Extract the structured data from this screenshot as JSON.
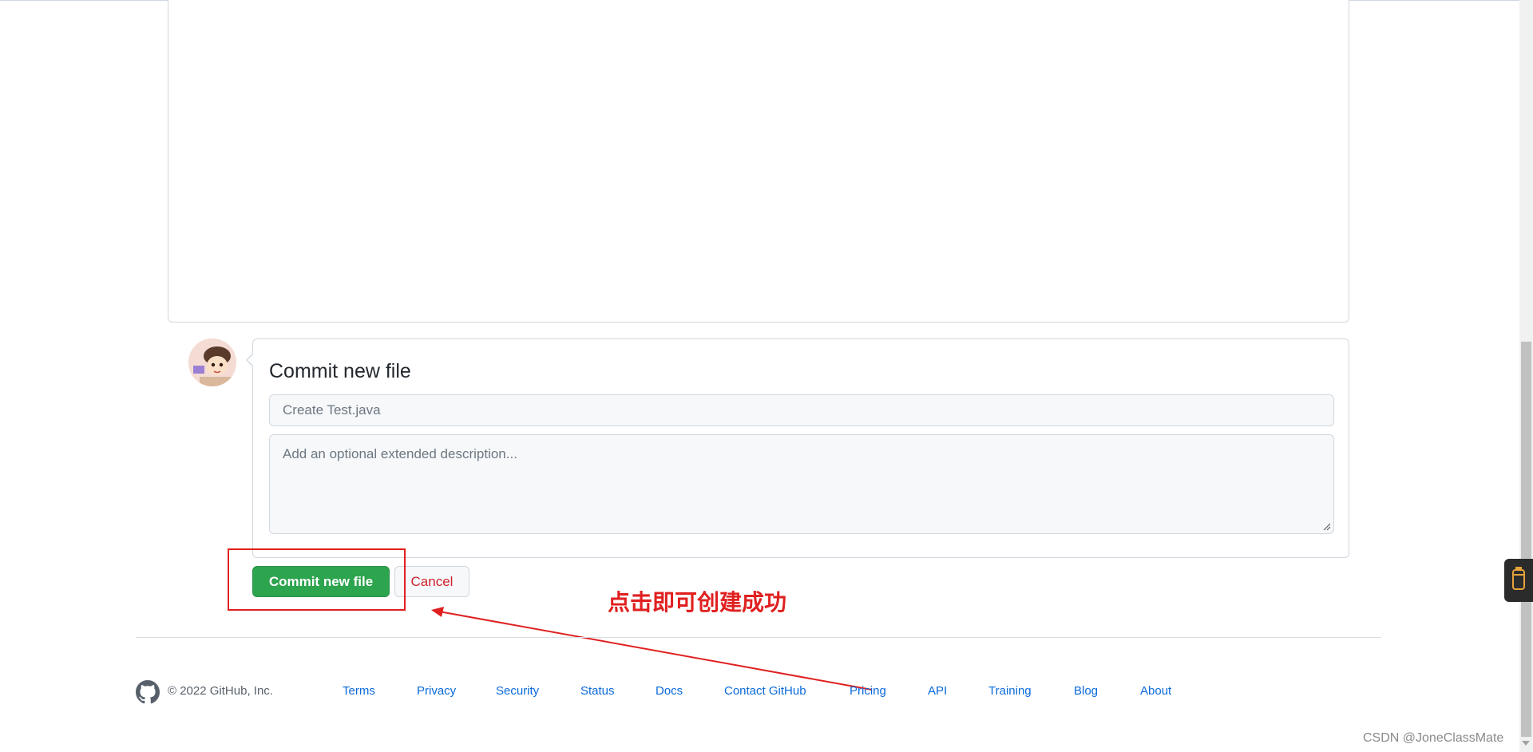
{
  "commit": {
    "title": "Commit new file",
    "summary_placeholder": "Create Test.java",
    "description_placeholder": "Add an optional extended description...",
    "commit_button_label": "Commit new file",
    "cancel_button_label": "Cancel"
  },
  "annotation": {
    "text": "点击即可创建成功",
    "color": "#e02020"
  },
  "footer": {
    "copyright": "© 2022 GitHub, Inc.",
    "links": [
      "Terms",
      "Privacy",
      "Security",
      "Status",
      "Docs",
      "Contact GitHub",
      "Pricing",
      "API",
      "Training",
      "Blog",
      "About"
    ]
  },
  "watermark": "CSDN @JoneClassMate",
  "colors": {
    "commit_green": "#2da44e",
    "cancel_red": "#cf222e",
    "link_blue": "#0969da",
    "border": "#d0d7de"
  },
  "icons": {
    "footer_logo": "github-mark-icon",
    "side_widget": "cup-icon"
  }
}
